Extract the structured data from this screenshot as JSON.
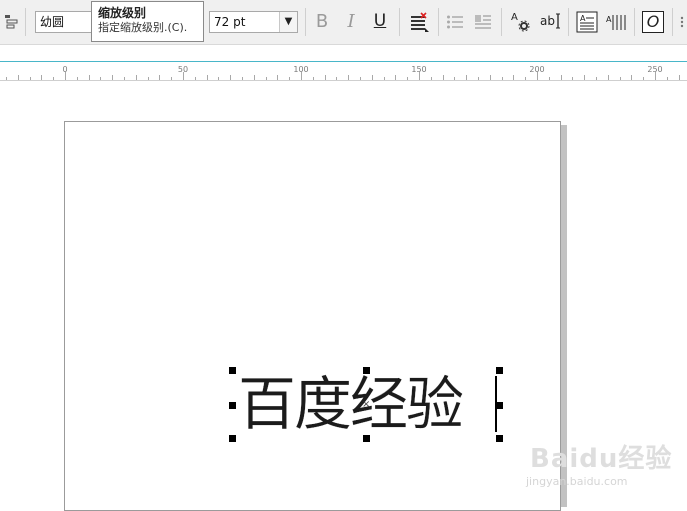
{
  "toolbar": {
    "font_name": "幼圆",
    "font_size": "72 pt",
    "bold_label": "B",
    "italic_label": "I",
    "underline_label": "U",
    "text_props_label": "ab",
    "font_size_dropdown_arrow": "▼",
    "glyph_a": "A",
    "italic_o": "O"
  },
  "tooltip": {
    "title": "缩放级别",
    "description": "指定缩放级别.(C)."
  },
  "ruler": {
    "labels": [
      "0",
      "50",
      "100",
      "150",
      "200",
      "250"
    ]
  },
  "canvas": {
    "artistic_text": "百度经验",
    "center_marker": "×"
  },
  "watermark": {
    "brand": "Baidu经验",
    "url": "jingyan.baidu.com"
  },
  "colors": {
    "ruler_accent": "#49b6c9",
    "toolbar_bg": "#f0f0f0"
  }
}
